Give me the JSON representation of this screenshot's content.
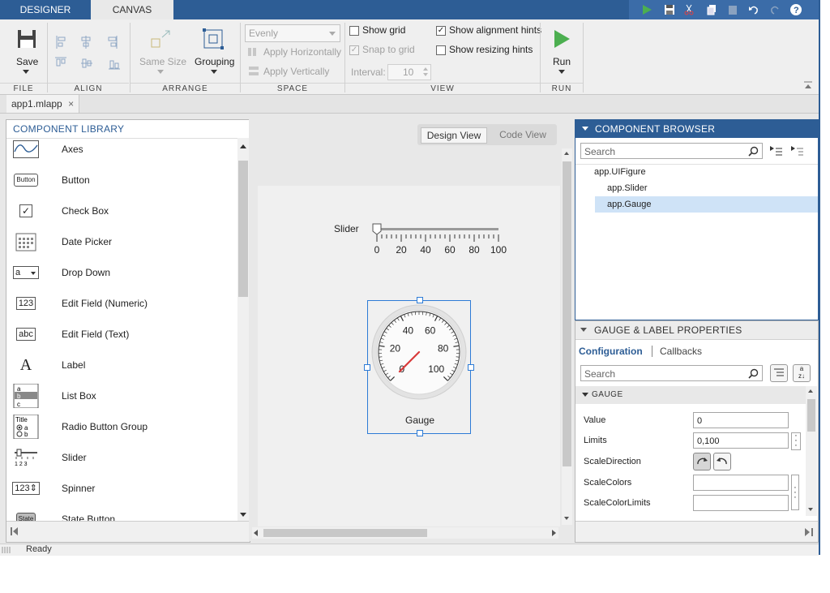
{
  "tabs": {
    "designer": "DESIGNER",
    "canvas": "CANVAS"
  },
  "ribbon": {
    "save": "Save",
    "same_size": "Same Size",
    "grouping": "Grouping",
    "space_mode": "Evenly",
    "apply_h": "Apply Horizontally",
    "apply_v": "Apply Vertically",
    "show_grid": "Show grid",
    "snap_to_grid": "Snap to grid",
    "interval_label": "Interval:",
    "interval_value": "10",
    "show_alignment": "Show alignment hints",
    "show_resizing": "Show resizing hints",
    "run": "Run",
    "sections": {
      "file": "FILE",
      "align": "ALIGN",
      "arrange": "ARRANGE",
      "space": "SPACE",
      "view": "VIEW",
      "run": "RUN"
    },
    "checks": {
      "show_grid": false,
      "snap_to_grid": true,
      "show_alignment": true,
      "show_resizing": false
    }
  },
  "doc_tab": "app1.mlapp",
  "library": {
    "title": "COMPONENT LIBRARY",
    "items": [
      {
        "label": "Axes",
        "icon": "axes-icon"
      },
      {
        "label": "Button",
        "icon": "button-icon",
        "glyph": "Button"
      },
      {
        "label": "Check Box",
        "icon": "checkbox-icon",
        "glyph": "✓"
      },
      {
        "label": "Date Picker",
        "icon": "calendar-icon"
      },
      {
        "label": "Drop Down",
        "icon": "dropdown-icon",
        "glyph": "a"
      },
      {
        "label": "Edit Field (Numeric)",
        "icon": "numeric-field-icon",
        "glyph": "123"
      },
      {
        "label": "Edit Field (Text)",
        "icon": "text-field-icon",
        "glyph": "abc"
      },
      {
        "label": "Label",
        "icon": "label-icon",
        "glyph": "A"
      },
      {
        "label": "List Box",
        "icon": "listbox-icon",
        "glyph": "a b c"
      },
      {
        "label": "Radio Button Group",
        "icon": "radio-group-icon",
        "glyph": "Title"
      },
      {
        "label": "Slider",
        "icon": "slider-icon",
        "glyph": "1 2 3"
      },
      {
        "label": "Spinner",
        "icon": "spinner-icon",
        "glyph": "123"
      },
      {
        "label": "State Button",
        "icon": "state-button-icon",
        "glyph": "State"
      }
    ]
  },
  "canvas": {
    "design_view": "Design View",
    "code_view": "Code View",
    "slider_label": "Slider",
    "slider_ticks": [
      "0",
      "20",
      "40",
      "60",
      "80",
      "100"
    ],
    "slider_value": 0,
    "gauge_label": "Gauge",
    "gauge_ticks": [
      "0",
      "20",
      "40",
      "60",
      "80",
      "100"
    ],
    "gauge_value": 0
  },
  "browser": {
    "title": "COMPONENT BROWSER",
    "search_placeholder": "Search",
    "tree": [
      {
        "label": "app.UIFigure",
        "selected": false
      },
      {
        "label": "app.Slider",
        "selected": false
      },
      {
        "label": "app.Gauge",
        "selected": true
      }
    ]
  },
  "props": {
    "title": "GAUGE & LABEL PROPERTIES",
    "tab_config": "Configuration",
    "tab_callbacks": "Callbacks",
    "search_placeholder": "Search",
    "group": "GAUGE",
    "rows": [
      {
        "label": "Value",
        "value": "0"
      },
      {
        "label": "Limits",
        "value": "0,100"
      },
      {
        "label": "ScaleDirection",
        "value": ""
      },
      {
        "label": "ScaleColors",
        "value": ""
      },
      {
        "label": "ScaleColorLimits",
        "value": ""
      }
    ]
  },
  "status": "Ready",
  "colors": {
    "accent": "#2d5d95",
    "selection": "#cfe3f7",
    "needle": "#d83a3a"
  }
}
